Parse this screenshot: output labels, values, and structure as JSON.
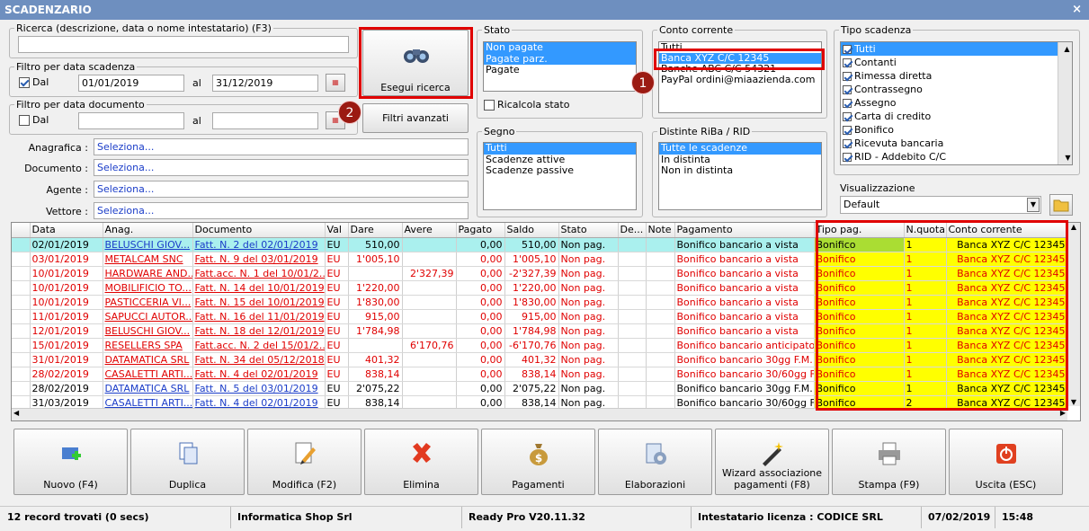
{
  "window": {
    "title": "SCADENZARIO",
    "close": "×"
  },
  "search": {
    "label": "Ricerca (descrizione, data o nome intestatario) (F3)",
    "value": ""
  },
  "filter_scadenza": {
    "label": "Filtro per data scadenza",
    "dal_label": "Dal",
    "from": "01/01/2019",
    "al_label": "al",
    "to": "31/12/2019",
    "checked": true
  },
  "filter_documento": {
    "label": "Filtro per data documento",
    "dal_label": "Dal",
    "from": "",
    "al_label": "al",
    "to": "",
    "checked": false
  },
  "buttons": {
    "search": "Esegui ricerca",
    "advanced": "Filtri avanzati"
  },
  "badges": [
    "1",
    "2"
  ],
  "fields": [
    {
      "label": "Anagrafica :",
      "value": "Seleziona..."
    },
    {
      "label": "Documento :",
      "value": "Seleziona..."
    },
    {
      "label": "Agente :",
      "value": "Seleziona..."
    },
    {
      "label": "Vettore :",
      "value": "Seleziona..."
    }
  ],
  "stato": {
    "label": "Stato",
    "items": [
      "Non pagate",
      "Pagate parz.",
      "Pagate"
    ],
    "recalc": "Ricalcola stato"
  },
  "segno": {
    "label": "Segno",
    "items": [
      "Tutti",
      "Scadenze attive",
      "Scadenze passive"
    ]
  },
  "conto": {
    "label": "Conto corrente",
    "items": [
      "Tutti",
      "Banca XYZ C/C 12345",
      "Banche ABC C/C 54321",
      "PayPal ordini@miaazienda.com"
    ]
  },
  "distinte": {
    "label": "Distinte RiBa / RID",
    "items": [
      "Tutte le scadenze",
      "In distinta",
      "Non in distinta"
    ]
  },
  "tipo": {
    "label": "Tipo scadenza",
    "items": [
      "Tutti",
      "Contanti",
      "Rimessa diretta",
      "Contrassegno",
      "Assegno",
      "Carta di credito",
      "Bonifico",
      "Ricevuta bancaria",
      "RID - Addebito C/C"
    ]
  },
  "visual": {
    "label": "Visualizzazione",
    "value": "Default"
  },
  "table": {
    "headers": [
      "Data",
      "Anag.",
      "Documento",
      "Val",
      "Dare",
      "Avere",
      "Pagato",
      "Saldo",
      "Stato",
      "De...",
      "Note",
      "Pagamento",
      "Tipo pag.",
      "N.quota",
      "Conto corrente"
    ],
    "rows": [
      [
        "02/01/2019",
        "BELUSCHI GIOV...",
        "Fatt. N. 2 del 02/01/2019",
        "EU",
        "510,00",
        "",
        "0,00",
        "510,00",
        "Non pag.",
        "",
        "",
        "Bonifico bancario a vista",
        "Bonifico",
        "1",
        "Banca XYZ C/C 12345"
      ],
      [
        "03/01/2019",
        "METALCAM SNC",
        "Fatt. N. 9 del 03/01/2019",
        "EU",
        "1'005,10",
        "",
        "0,00",
        "1'005,10",
        "Non pag.",
        "",
        "",
        "Bonifico bancario a vista",
        "Bonifico",
        "1",
        "Banca XYZ C/C 12345"
      ],
      [
        "10/01/2019",
        "HARDWARE AND...",
        "Fatt.acc. N. 1 del 10/01/2...",
        "EU",
        "",
        "2'327,39",
        "0,00",
        "-2'327,39",
        "Non pag.",
        "",
        "",
        "Bonifico bancario a vista",
        "Bonifico",
        "1",
        "Banca XYZ C/C 12345"
      ],
      [
        "10/01/2019",
        "MOBILIFICIO TO...",
        "Fatt. N. 14 del 10/01/2019",
        "EU",
        "1'220,00",
        "",
        "0,00",
        "1'220,00",
        "Non pag.",
        "",
        "",
        "Bonifico bancario a vista",
        "Bonifico",
        "1",
        "Banca XYZ C/C 12345"
      ],
      [
        "10/01/2019",
        "PASTICCERIA VI...",
        "Fatt. N. 15 del 10/01/2019",
        "EU",
        "1'830,00",
        "",
        "0,00",
        "1'830,00",
        "Non pag.",
        "",
        "",
        "Bonifico bancario a vista",
        "Bonifico",
        "1",
        "Banca XYZ C/C 12345"
      ],
      [
        "11/01/2019",
        "SAPUCCI AUTOR...",
        "Fatt. N. 16 del 11/01/2019",
        "EU",
        "915,00",
        "",
        "0,00",
        "915,00",
        "Non pag.",
        "",
        "",
        "Bonifico bancario a vista",
        "Bonifico",
        "1",
        "Banca XYZ C/C 12345"
      ],
      [
        "12/01/2019",
        "BELUSCHI GIOV...",
        "Fatt. N. 18 del 12/01/2019",
        "EU",
        "1'784,98",
        "",
        "0,00",
        "1'784,98",
        "Non pag.",
        "",
        "",
        "Bonifico bancario a vista",
        "Bonifico",
        "1",
        "Banca XYZ C/C 12345"
      ],
      [
        "15/01/2019",
        "RESELLERS SPA",
        "Fatt.acc. N. 2 del 15/01/2...",
        "EU",
        "",
        "6'170,76",
        "0,00",
        "-6'170,76",
        "Non pag.",
        "",
        "",
        "Bonifico bancario anticipato",
        "Bonifico",
        "1",
        "Banca XYZ C/C 12345"
      ],
      [
        "31/01/2019",
        "DATAMATICA SRL",
        "Fatt. N. 34 del 05/12/2018",
        "EU",
        "401,32",
        "",
        "0,00",
        "401,32",
        "Non pag.",
        "",
        "",
        "Bonifico bancario 30gg F.M.",
        "Bonifico",
        "1",
        "Banca XYZ C/C 12345"
      ],
      [
        "28/02/2019",
        "CASALETTI ARTI...",
        "Fatt. N. 4 del 02/01/2019",
        "EU",
        "838,14",
        "",
        "0,00",
        "838,14",
        "Non pag.",
        "",
        "",
        "Bonifico bancario 30/60gg F.M.",
        "Bonifico",
        "1",
        "Banca XYZ C/C 12345"
      ],
      [
        "28/02/2019",
        "DATAMATICA SRL",
        "Fatt. N. 5 del 03/01/2019",
        "EU",
        "2'075,22",
        "",
        "0,00",
        "2'075,22",
        "Non pag.",
        "",
        "",
        "Bonifico bancario 30gg F.M.",
        "Bonifico",
        "1",
        "Banca XYZ C/C 12345"
      ],
      [
        "31/03/2019",
        "CASALETTI ARTI...",
        "Fatt. N. 4 del 02/01/2019",
        "EU",
        "838,14",
        "",
        "0,00",
        "838,14",
        "Non pag.",
        "",
        "",
        "Bonifico bancario 30/60gg F.M.",
        "Bonifico",
        "2",
        "Banca XYZ C/C 12345"
      ]
    ],
    "red_rows": [
      1,
      2,
      3,
      4,
      5,
      6,
      7,
      8,
      9
    ]
  },
  "toolbar": [
    {
      "label": "Nuovo (F4)",
      "icon": "new-icon"
    },
    {
      "label": "Duplica",
      "icon": "duplicate-icon"
    },
    {
      "label": "Modifica (F2)",
      "icon": "edit-icon"
    },
    {
      "label": "Elimina",
      "icon": "delete-icon"
    },
    {
      "label": "Pagamenti",
      "icon": "money-bag-icon"
    },
    {
      "label": "Elaborazioni",
      "icon": "process-icon"
    },
    {
      "label": "Wizard associazione pagamenti (F8)",
      "icon": "magic-wand-icon"
    },
    {
      "label": "Stampa (F9)",
      "icon": "printer-icon"
    },
    {
      "label": "Uscita (ESC)",
      "icon": "exit-icon"
    }
  ],
  "status": {
    "records": "12 record trovati (0 secs)",
    "company": "Informatica Shop Srl",
    "version": "Ready Pro V20.11.32",
    "license": "Intestatario licenza : CODICE SRL",
    "date": "07/02/2019",
    "time": "15:48"
  },
  "colors": {
    "title": "#6e8fbf",
    "selection": "#3399ff",
    "highlight": "#ffff00",
    "red_text": "#e00000",
    "callout": "#e00000"
  }
}
